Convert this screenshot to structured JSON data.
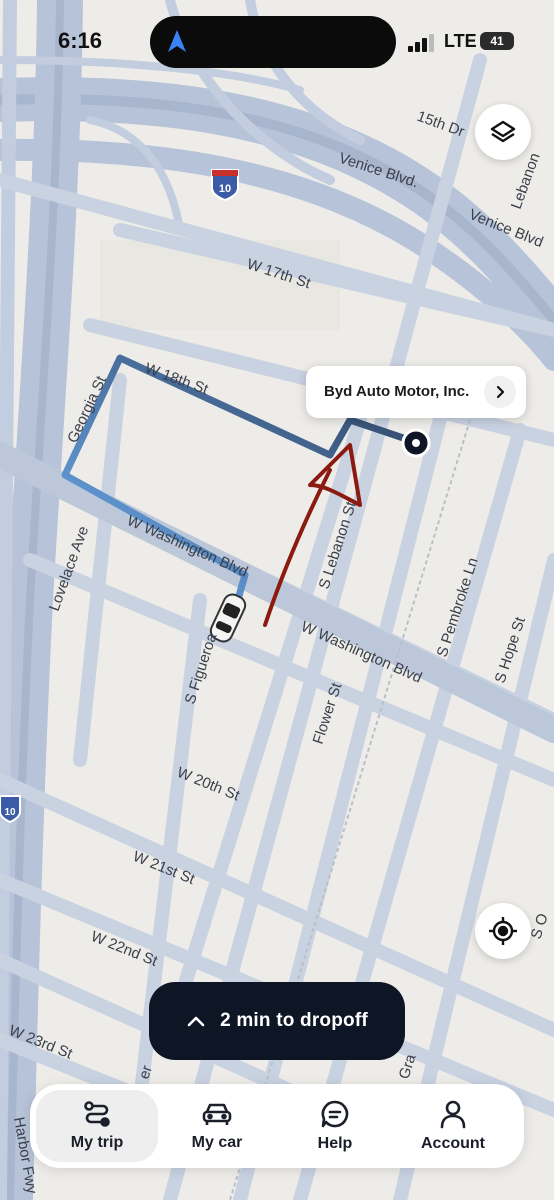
{
  "status_bar": {
    "time": "6:16",
    "network": "LTE",
    "battery": "41"
  },
  "map": {
    "streets": [
      "15th Dr",
      "Venice Blvd.",
      "Venice Blvd",
      "Lebanon",
      "W 17th St",
      "W 18th St",
      "Georgia St",
      "Lovelace Ave",
      "W Washington Blvd",
      "W Washington Blvd",
      "S Lebanon St",
      "S Figueroa",
      "Flower St",
      "S Pembroke Ln",
      "S Hope St",
      "W 20th St",
      "W 21st St",
      "W 22nd St",
      "W 23rd St",
      "Harbor Fwy",
      "Gra",
      "S O",
      "er"
    ],
    "freeway_shield": "10",
    "route_colors": {
      "start": "#6fb0f5",
      "end": "#2c3e5a"
    },
    "annotation_color": "#8b1a10"
  },
  "destination": {
    "name": "Byd Auto Motor, Inc."
  },
  "trip": {
    "eta_text": "2 min to dropoff"
  },
  "tabs": [
    {
      "label": "My trip",
      "icon": "route-icon",
      "active": true
    },
    {
      "label": "My car",
      "icon": "car-icon",
      "active": false
    },
    {
      "label": "Help",
      "icon": "chat-help-icon",
      "active": false
    },
    {
      "label": "Account",
      "icon": "person-icon",
      "active": false
    }
  ]
}
